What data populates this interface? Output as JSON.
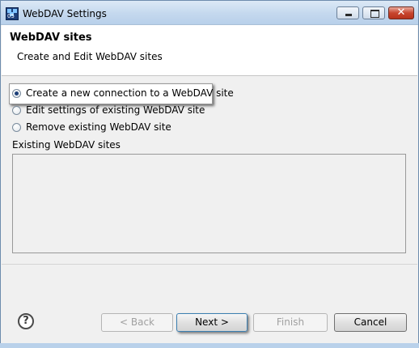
{
  "window": {
    "title": "WebDAV Settings",
    "icon_label": "05"
  },
  "header": {
    "title": "WebDAV sites",
    "subtitle": "Create and Edit WebDAV sites"
  },
  "options": [
    {
      "label": "Create a new connection to a WebDAV site",
      "checked": true
    },
    {
      "label": "Edit settings of existing WebDAV site",
      "checked": false
    },
    {
      "label": "Remove existing WebDAV site",
      "checked": false
    }
  ],
  "sites": {
    "label": "Existing WebDAV sites",
    "items": []
  },
  "buttons": {
    "help": "?",
    "back": "< Back",
    "next": "Next >",
    "finish": "Finish",
    "cancel": "Cancel"
  },
  "icons": {
    "app": "eclipse-app-icon",
    "minimize": "minimize-icon",
    "maximize": "maximize-icon",
    "close": "close-icon",
    "help": "help-icon"
  }
}
